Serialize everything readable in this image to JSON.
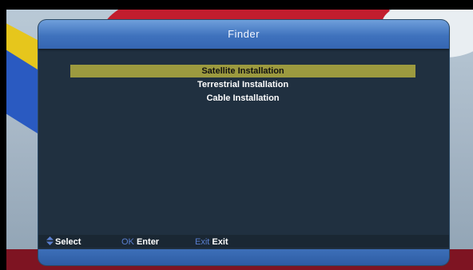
{
  "dialog": {
    "title": "Finder"
  },
  "menu": {
    "items": [
      {
        "label": "Satellite Installation",
        "selected": true
      },
      {
        "label": "Terrestrial Installation",
        "selected": false
      },
      {
        "label": "Cable Installation",
        "selected": false
      }
    ]
  },
  "footer": {
    "select_label": "Select",
    "ok_key": "OK",
    "enter_label": "Enter",
    "exit_key": "Exit",
    "exit_label": "Exit"
  },
  "colors": {
    "selection": "#9c9a3f",
    "header": "#3f72bd",
    "panel": "#203040",
    "key_hint": "#5a7fd0"
  }
}
